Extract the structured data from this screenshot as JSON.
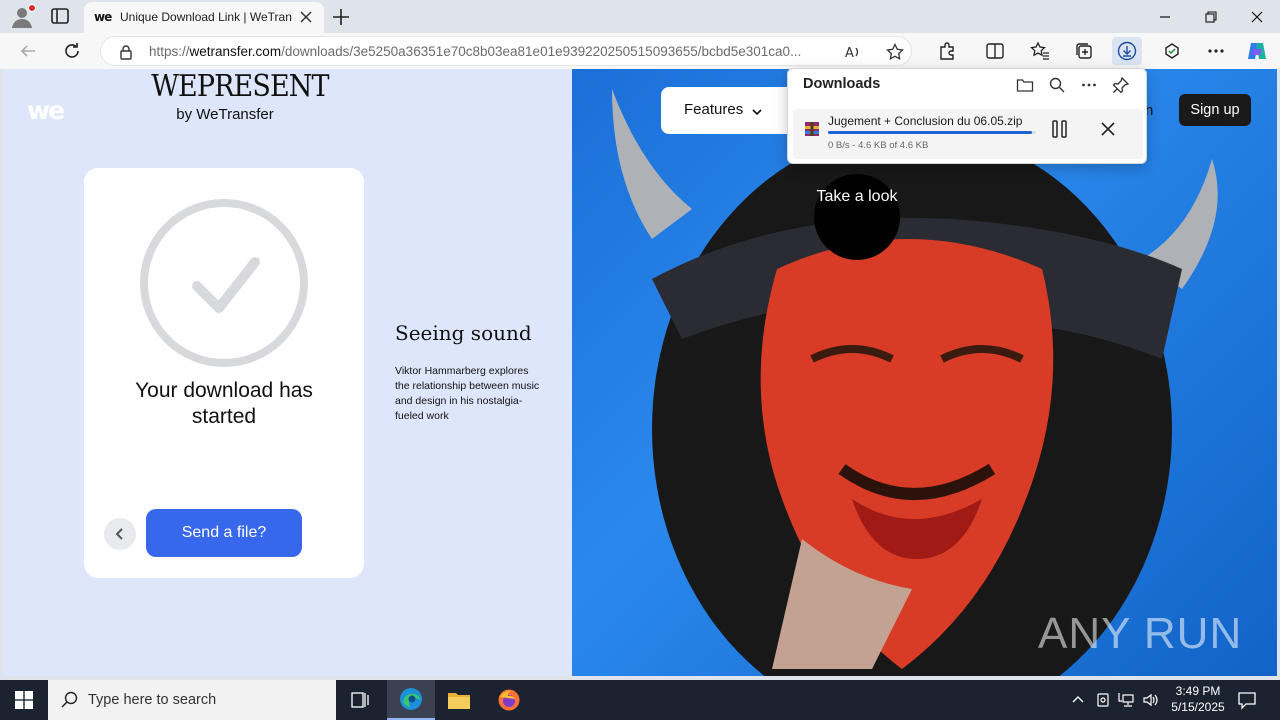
{
  "browser": {
    "tab_title": "Unique Download Link | WeTransfer",
    "tab_favicon_text": "we",
    "url_prefix": "https://",
    "url_domain": "wetransfer.com",
    "url_path": "/downloads/3e5250a36351e70c8b03ea81e01e939220250515093655/bcbd5e301ca0..."
  },
  "downloads": {
    "header": "Downloads",
    "item": {
      "filename": "Jugement + Conclusion du 06.05.zip",
      "status": "0 B/s - 4.6 KB of 4.6 KB",
      "progress": 0.98
    }
  },
  "page": {
    "logo": "we",
    "wepresent_title": "WEPRESENT",
    "wepresent_sub": "by WeTransfer",
    "card_title": "Your download has started",
    "send_button": "Send a file?",
    "article_title": "Seeing sound",
    "article_desc": "Viktor Hammarberg explores the relationship between music and design in his nostalgia-fueled work",
    "nav_features": "Features",
    "nav_login_fragment": "n",
    "sign_up": "Sign up",
    "take_look": "Take a look",
    "watermark": "ANY RUN"
  },
  "taskbar": {
    "search_placeholder": "Type here to search",
    "time": "3:49 PM",
    "date": "5/15/2025"
  },
  "colors": {
    "accent_blue": "#3767ea",
    "page_bg": "#dde6fb",
    "progress": "#1c63d6"
  }
}
